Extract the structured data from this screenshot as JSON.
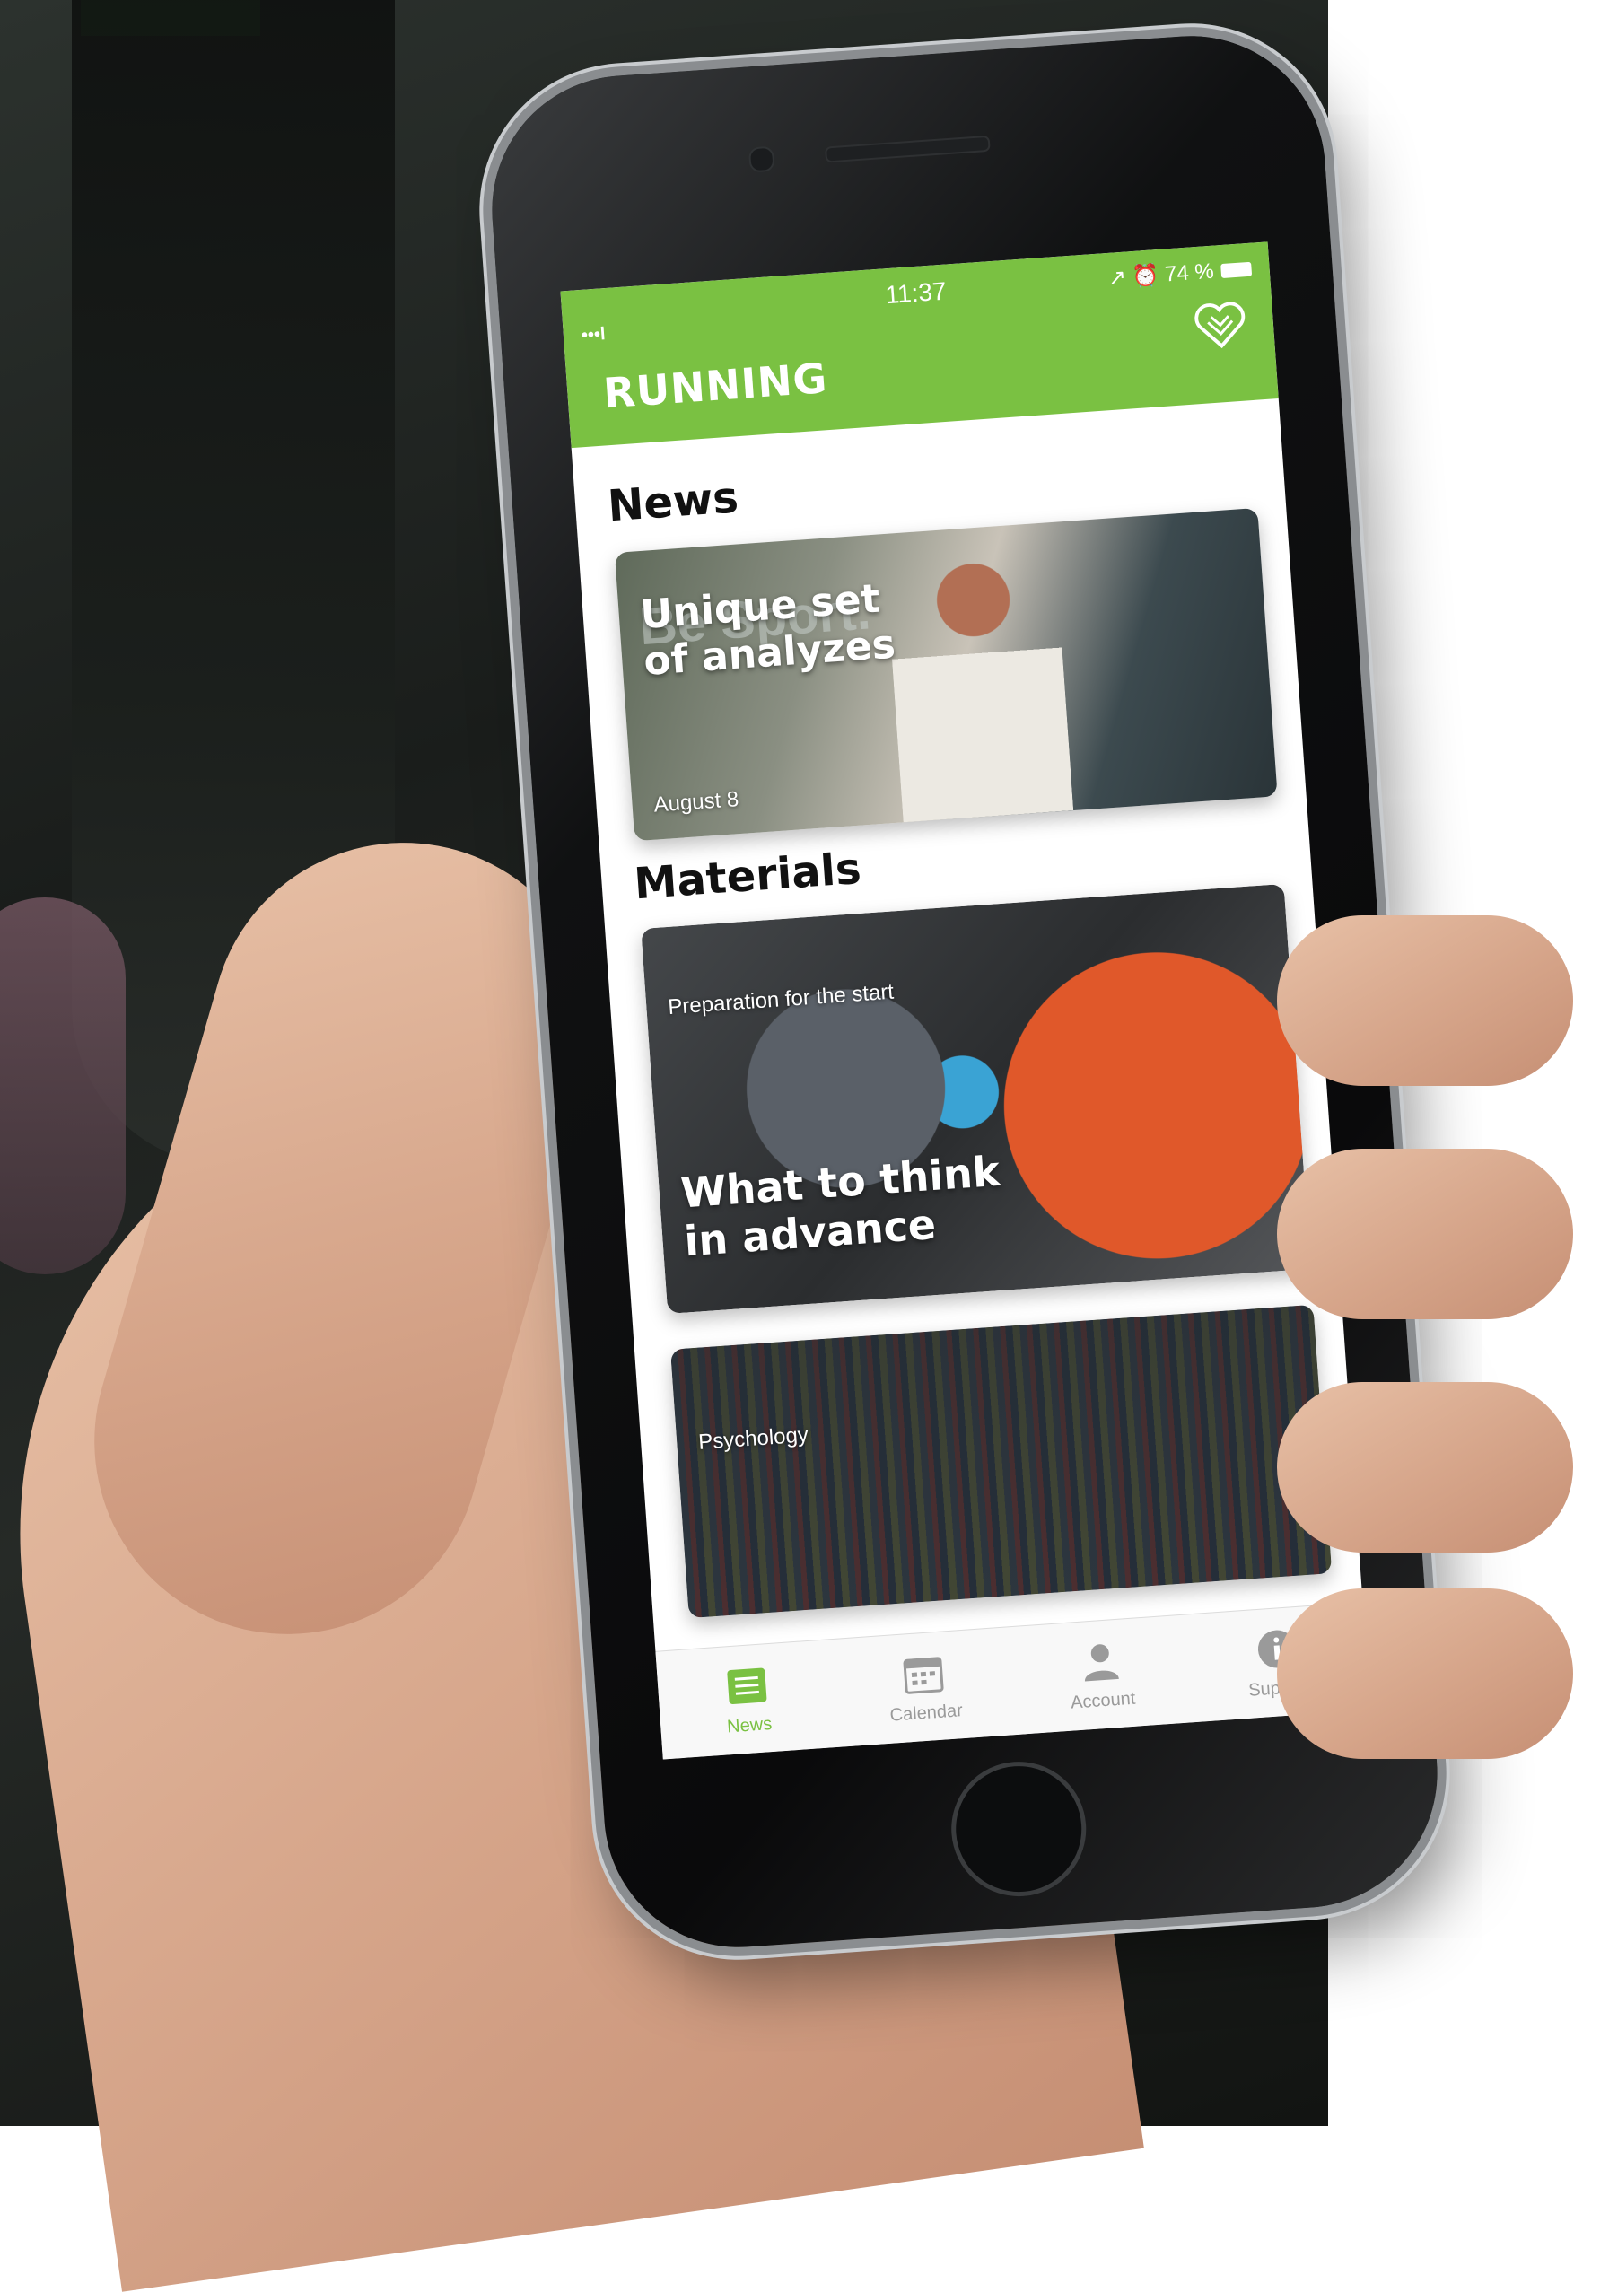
{
  "status_bar": {
    "signal": "•••l",
    "time": "11:37",
    "indicators": "↗ ⏰ 74 %"
  },
  "header": {
    "title": "RUNNING",
    "favorites_icon": "heart-icon"
  },
  "news": {
    "section_title": "News",
    "card": {
      "title": "Unique set of analyzes",
      "background_text": "Be Sport.",
      "date": "August 8"
    }
  },
  "materials": {
    "section_title": "Materials",
    "cards": [
      {
        "category": "Preparation for the start",
        "title": "What to think in advance"
      },
      {
        "category": "Psychology"
      }
    ]
  },
  "tab_bar": {
    "tabs": [
      {
        "label": "News",
        "icon": "news-list-icon",
        "active": true
      },
      {
        "label": "Calendar",
        "icon": "calendar-icon",
        "active": false
      },
      {
        "label": "Account",
        "icon": "person-icon",
        "active": false
      },
      {
        "label": "Support",
        "icon": "info-icon",
        "active": false
      }
    ]
  },
  "colors": {
    "brand_green": "#7ac142",
    "tab_inactive": "#9a9a9a"
  }
}
